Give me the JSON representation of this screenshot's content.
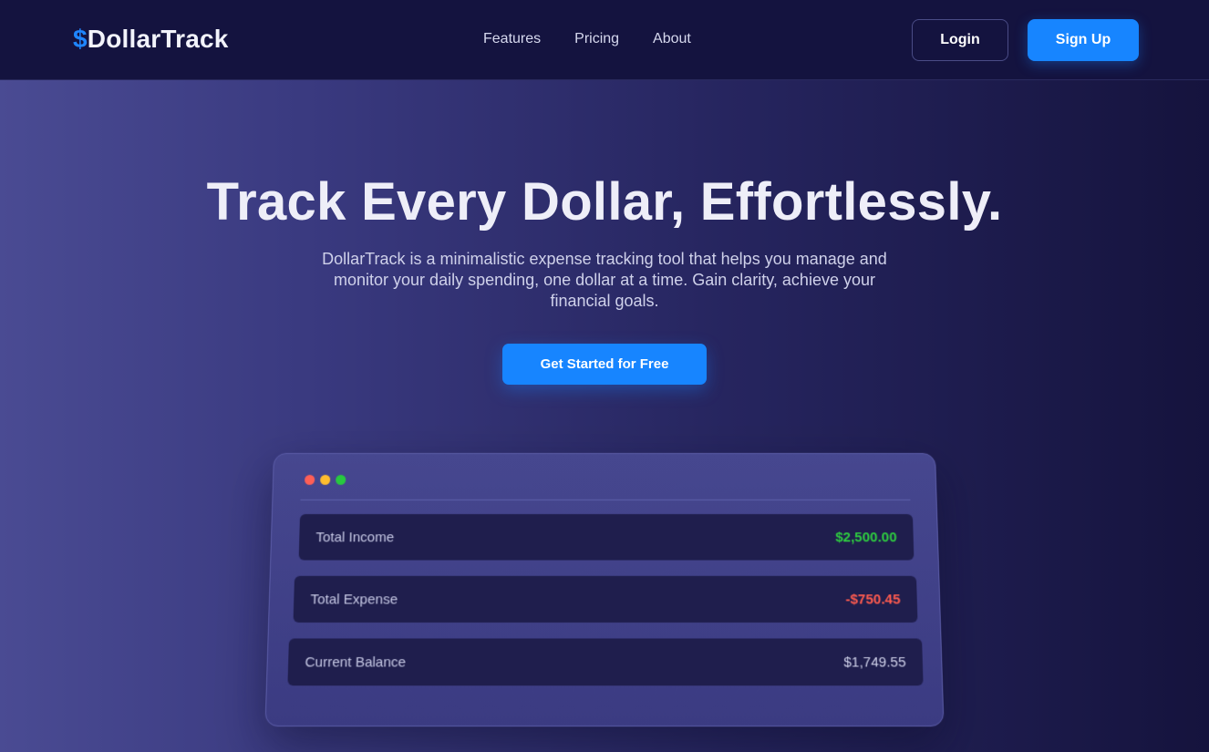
{
  "brand": {
    "symbol": "$",
    "name": "DollarTrack",
    "accent_color": "#1785ff"
  },
  "nav": {
    "links": [
      "Features",
      "Pricing",
      "About"
    ]
  },
  "auth": {
    "login_label": "Login",
    "signup_label": "Sign Up"
  },
  "hero": {
    "title": "Track Every Dollar, Effortlessly.",
    "subtitle": "DollarTrack is a minimalistic expense tracking tool that helps you manage and monitor your daily spending, one dollar at a time. Gain clarity, achieve your financial goals.",
    "cta_label": "Get Started for Free"
  },
  "preview": {
    "window_dots": [
      "red",
      "yellow",
      "green"
    ],
    "rows": [
      {
        "label": "Total Income",
        "value": "$2,500.00",
        "color": "#2ecc40"
      },
      {
        "label": "Total Expense",
        "value": "-$750.45",
        "color": "#ff5b4f"
      },
      {
        "label": "Current Balance",
        "value": "$1,749.55",
        "color": "#d0d2ea"
      }
    ]
  }
}
